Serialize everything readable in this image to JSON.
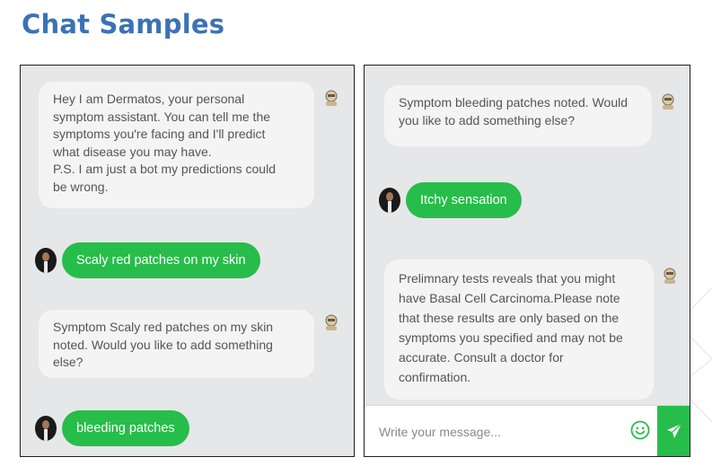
{
  "title": "Chat Samples",
  "colors": {
    "title": "#3c72b5",
    "user_bubble": "#27bd4a",
    "bot_bubble": "#f4f4f5",
    "panel_bg": "#e6e7e9"
  },
  "left_chat": {
    "messages": [
      {
        "sender": "bot",
        "text": "Hey I am Dermatos, your personal\nsymptom assistant. You can tell me the\nsymptoms you're facing and I'll predict\nwhat disease you may have.\nP.S. I am just a bot my predictions could\nbe wrong."
      },
      {
        "sender": "user",
        "text": "Scaly red patches on my skin"
      },
      {
        "sender": "bot",
        "text": "Symptom Scaly red patches on my skin\nnoted. Would you like to add something\nelse?"
      },
      {
        "sender": "user",
        "text": "bleeding patches"
      }
    ]
  },
  "right_chat": {
    "messages": [
      {
        "sender": "bot",
        "text": "Symptom bleeding patches noted. Would\nyou like to add something else?"
      },
      {
        "sender": "user",
        "text": "Itchy sensation"
      },
      {
        "sender": "bot",
        "text": "Prelimnary tests reveals that you might\nhave Basal Cell Carcinoma.Please note\nthat these results are only based on the\nsymptoms you specified and may not be\naccurate. Consult a doctor for\nconfirmation."
      }
    ],
    "input": {
      "placeholder": "Write your message..."
    },
    "icons": {
      "emoji": "smiley-icon",
      "send": "paper-plane-icon"
    }
  }
}
